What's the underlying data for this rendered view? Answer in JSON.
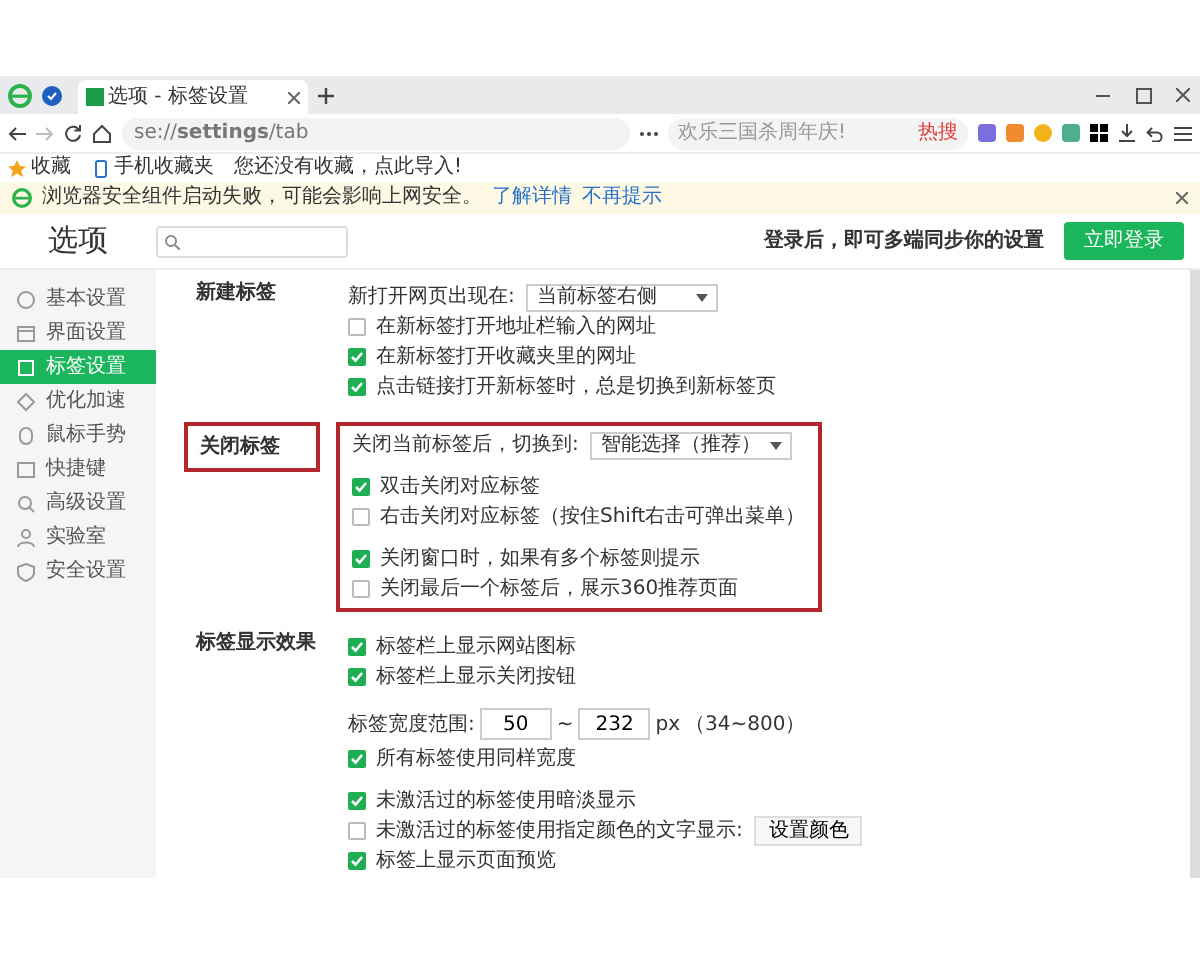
{
  "browser": {
    "tab_title": "选项 - 标签设置",
    "address": "se://**settings**/tab",
    "search_placeholder": "欢乐三国杀周年庆!",
    "hot_label": "热搜",
    "bookmarks": [
      "收藏",
      "手机收藏夹"
    ],
    "bookmarks_hint": "您还没有收藏，点此导入!"
  },
  "info_bar": {
    "message": "浏览器安全组件启动失败，可能会影响上网安全。",
    "links": [
      "了解详情",
      "不再提示"
    ]
  },
  "settings": {
    "title": "选项",
    "login_hint": "登录后，即可多端同步你的设置",
    "login_button": "立即登录"
  },
  "sidebar": [
    {
      "label": "基本设置",
      "selected": false
    },
    {
      "label": "界面设置",
      "selected": false
    },
    {
      "label": "标签设置",
      "selected": true
    },
    {
      "label": "优化加速",
      "selected": false
    },
    {
      "label": "鼠标手势",
      "selected": false
    },
    {
      "label": "快捷键",
      "selected": false
    },
    {
      "label": "高级设置",
      "selected": false
    },
    {
      "label": "实验室",
      "selected": false
    },
    {
      "label": "安全设置",
      "selected": false
    }
  ],
  "sections": [
    {
      "title": "新建标签",
      "highlighted": false,
      "groups": [
        [
          {
            "kind": "select",
            "label": "新打开网页出现在:",
            "value": "当前标签右侧"
          },
          {
            "kind": "checkbox",
            "label": "在新标签打开地址栏输入的网址",
            "checked": false
          },
          {
            "kind": "checkbox",
            "label": "在新标签打开收藏夹里的网址",
            "checked": true
          },
          {
            "kind": "checkbox",
            "label": "点击链接打开新标签时，总是切换到新标签页",
            "checked": true
          }
        ]
      ]
    },
    {
      "title": "关闭标签",
      "highlighted": true,
      "groups": [
        [
          {
            "kind": "select",
            "label": "关闭当前标签后，切换到:",
            "value": "智能选择（推荐）"
          }
        ],
        [
          {
            "kind": "checkbox",
            "label": "双击关闭对应标签",
            "checked": true
          },
          {
            "kind": "checkbox",
            "label": "右击关闭对应标签（按住Shift右击可弹出菜单）",
            "checked": false
          }
        ],
        [
          {
            "kind": "checkbox",
            "label": "关闭窗口时，如果有多个标签则提示",
            "checked": true
          },
          {
            "kind": "checkbox",
            "label": "关闭最后一个标签后，展示360推荐页面",
            "checked": false
          }
        ]
      ]
    },
    {
      "title": "标签显示效果",
      "highlighted": false,
      "groups": [
        [
          {
            "kind": "checkbox",
            "label": "标签栏上显示网站图标",
            "checked": true
          },
          {
            "kind": "checkbox",
            "label": "标签栏上显示关闭按钮",
            "checked": true
          }
        ],
        [
          {
            "kind": "range",
            "label": "标签宽度范围:",
            "min": "50",
            "separator": "~",
            "max": "232",
            "unit": "px",
            "hint": "（34~800）"
          },
          {
            "kind": "checkbox",
            "label": "所有标签使用同样宽度",
            "checked": true
          }
        ],
        [
          {
            "kind": "checkbox",
            "label": "未激活过的标签使用暗淡显示",
            "checked": true
          },
          {
            "kind": "checkbox",
            "label": "未激活过的标签使用指定颜色的文字显示:",
            "checked": false,
            "button": "设置颜色"
          },
          {
            "kind": "checkbox",
            "label": "标签上显示页面预览",
            "checked": true
          }
        ]
      ]
    }
  ]
}
